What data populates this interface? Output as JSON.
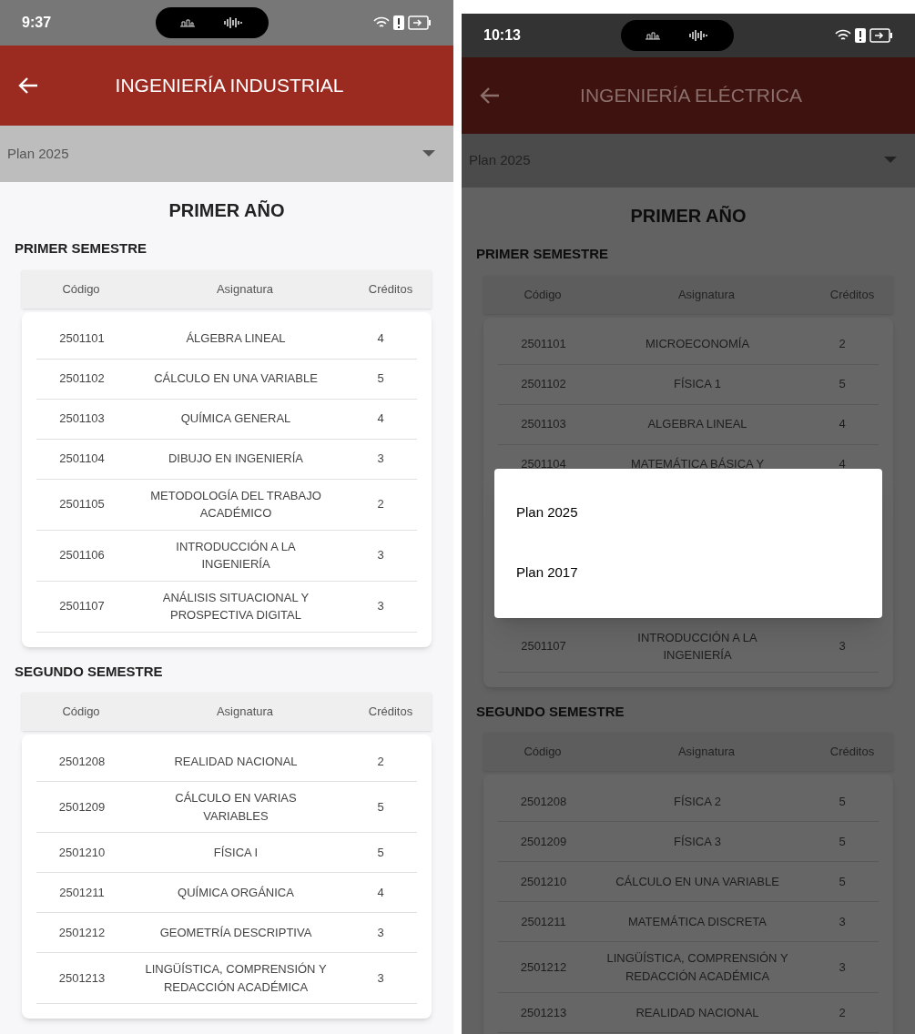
{
  "screens": [
    {
      "dimmed": false,
      "status_bar": {
        "time": "9:37"
      },
      "app_bar": {
        "title": "INGENIERÍA INDUSTRIAL"
      },
      "plan_select": {
        "value": "Plan 2025"
      },
      "year": {
        "title": "PRIMER AÑO",
        "semesters": [
          {
            "title": "PRIMER SEMESTRE",
            "columns": [
              "Código",
              "Asignatura",
              "Créditos"
            ],
            "rows": [
              {
                "code": "2501101",
                "subject": "ÁLGEBRA LINEAL",
                "credits": "4"
              },
              {
                "code": "2501102",
                "subject": "CÁLCULO EN UNA VARIABLE",
                "credits": "5"
              },
              {
                "code": "2501103",
                "subject": "QUÍMICA GENERAL",
                "credits": "4"
              },
              {
                "code": "2501104",
                "subject": "DIBUJO EN INGENIERÍA",
                "credits": "3"
              },
              {
                "code": "2501105",
                "subject": "METODOLOGÍA DEL TRABAJO ACADÉMICO",
                "credits": "2"
              },
              {
                "code": "2501106",
                "subject": "INTRODUCCIÓN A LA INGENIERÍA",
                "credits": "3"
              },
              {
                "code": "2501107",
                "subject": "ANÁLISIS SITUACIONAL Y PROSPECTIVA DIGITAL",
                "credits": "3"
              }
            ]
          },
          {
            "title": "SEGUNDO SEMESTRE",
            "columns": [
              "Código",
              "Asignatura",
              "Créditos"
            ],
            "rows": [
              {
                "code": "2501208",
                "subject": "REALIDAD NACIONAL",
                "credits": "2"
              },
              {
                "code": "2501209",
                "subject": "CÁLCULO EN VARIAS VARIABLES",
                "credits": "5"
              },
              {
                "code": "2501210",
                "subject": "FÍSICA I",
                "credits": "5"
              },
              {
                "code": "2501211",
                "subject": "QUÍMICA ORGÁNICA",
                "credits": "4"
              },
              {
                "code": "2501212",
                "subject": "GEOMETRÍA DESCRIPTIVA",
                "credits": "3"
              },
              {
                "code": "2501213",
                "subject": "LINGÜÍSTICA, COMPRENSIÓN Y REDACCIÓN ACADÉMICA",
                "credits": "3"
              }
            ]
          }
        ]
      }
    },
    {
      "dimmed": true,
      "status_bar": {
        "time": "10:13"
      },
      "app_bar": {
        "title": "INGENIERÍA ELÉCTRICA"
      },
      "plan_select": {
        "value": "Plan 2025"
      },
      "menu": {
        "options": [
          {
            "label": "Plan 2025"
          },
          {
            "label": "Plan 2017"
          }
        ]
      },
      "year": {
        "title": "PRIMER AÑO",
        "semesters": [
          {
            "title": "PRIMER SEMESTRE",
            "columns": [
              "Código",
              "Asignatura",
              "Créditos"
            ],
            "rows": [
              {
                "code": "2501101",
                "subject": "MICROECONOMÍA",
                "credits": "2"
              },
              {
                "code": "2501102",
                "subject": "FÍSICA 1",
                "credits": "5"
              },
              {
                "code": "2501103",
                "subject": "ALGEBRA LINEAL",
                "credits": "4"
              },
              {
                "code": "2501104",
                "subject": "MATEMÁTICA BÁSICA Y",
                "credits": "4"
              },
              {
                "code": "2501107",
                "subject": "INTRODUCCIÓN A LA INGENIERÍA",
                "credits": "3"
              }
            ]
          },
          {
            "title": "SEGUNDO SEMESTRE",
            "columns": [
              "Código",
              "Asignatura",
              "Créditos"
            ],
            "rows": [
              {
                "code": "2501208",
                "subject": "FÍSICA 2",
                "credits": "5"
              },
              {
                "code": "2501209",
                "subject": "FÍSICA 3",
                "credits": "5"
              },
              {
                "code": "2501210",
                "subject": "CÁLCULO EN UNA VARIABLE",
                "credits": "5"
              },
              {
                "code": "2501211",
                "subject": "MATEMÁTICA DISCRETA",
                "credits": "3"
              },
              {
                "code": "2501212",
                "subject": "LINGÜÍSTICA, COMPRENSIÓN Y REDACCIÓN ACADÉMICA",
                "credits": "3"
              },
              {
                "code": "2501213",
                "subject": "REALIDAD NACIONAL",
                "credits": "2"
              }
            ]
          }
        ]
      }
    }
  ]
}
